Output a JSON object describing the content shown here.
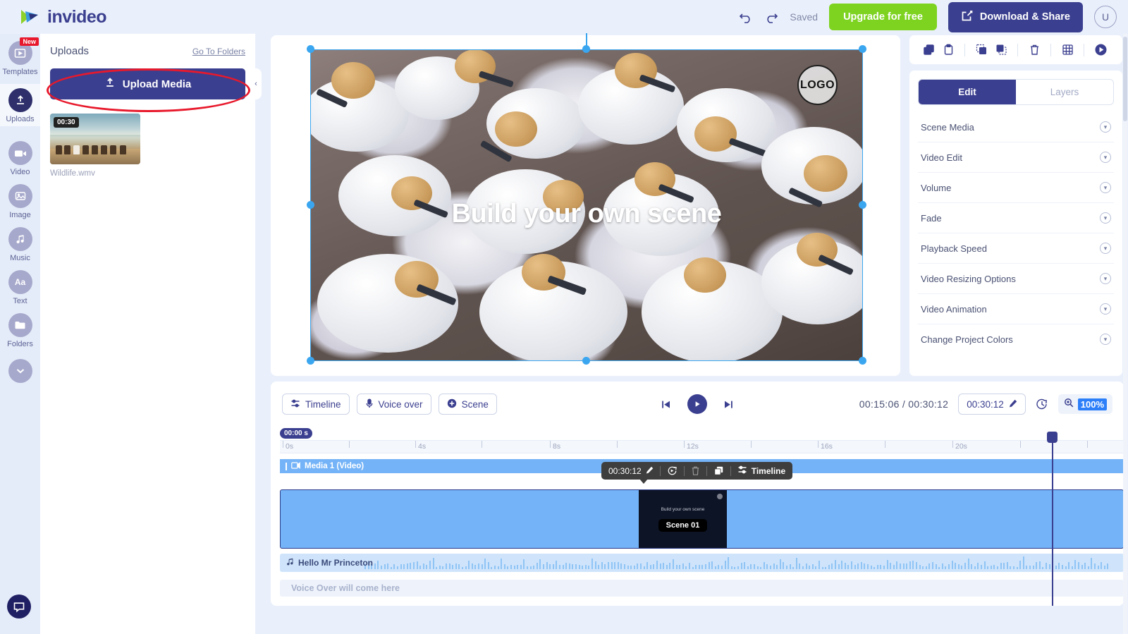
{
  "header": {
    "brand": "invideo",
    "undo_icon": "undo-icon",
    "redo_icon": "redo-icon",
    "saved_label": "Saved",
    "upgrade_label": "Upgrade for free",
    "download_label": "Download & Share",
    "avatar_initial": "U"
  },
  "rail": {
    "items": [
      {
        "label": "Templates",
        "icon": "templates-icon",
        "badge": "New",
        "active": false
      },
      {
        "label": "Uploads",
        "icon": "upload-icon",
        "badge": "",
        "active": true
      },
      {
        "label": "Video",
        "icon": "video-camera-icon",
        "badge": "",
        "active": false
      },
      {
        "label": "Image",
        "icon": "image-icon",
        "badge": "",
        "active": false
      },
      {
        "label": "Music",
        "icon": "music-note-icon",
        "badge": "",
        "active": false
      },
      {
        "label": "Text",
        "icon": "text-aa-icon",
        "badge": "",
        "active": false
      },
      {
        "label": "Folders",
        "icon": "folder-icon",
        "badge": "",
        "active": false
      },
      {
        "label": "",
        "icon": "chevron-down-icon",
        "badge": "",
        "active": false
      }
    ],
    "chat_icon": "chat-bubble-icon"
  },
  "panel": {
    "title": "Uploads",
    "link": "Go To Folders",
    "upload_button": "Upload Media",
    "upload_icon": "upload-arrow-icon",
    "media": [
      {
        "duration": "00:30",
        "name": "Wildlife.wmv"
      }
    ],
    "collapse_icon": "chevron-left-icon"
  },
  "canvas": {
    "logo_text": "LOGO",
    "scene_text": "Build your own scene"
  },
  "timeline": {
    "buttons": [
      {
        "label": "Timeline",
        "icon": "timeline-icon"
      },
      {
        "label": "Voice over",
        "icon": "microphone-icon"
      },
      {
        "label": "Scene",
        "icon": "plus-circle-icon"
      }
    ],
    "transport": {
      "prev_icon": "skip-previous-icon",
      "play_icon": "play-icon",
      "next_icon": "skip-next-icon"
    },
    "current_time": "00:15:06",
    "separator": "/",
    "total_time": "00:30:12",
    "duration_value": "00:30:12",
    "duration_edit_icon": "pencil-icon",
    "history_icon": "history-clock-icon",
    "zoom_icon": "zoom-in-icon",
    "zoom_value": "100%",
    "start_chip": "00:00 s",
    "ruler_labels": [
      "0s",
      "4s",
      "8s",
      "12s",
      "16s",
      "20s"
    ],
    "track_label": "Media 1 (Video)",
    "track_icon": "video-clip-icon",
    "clip_toolbar": {
      "duration": "00:30:12",
      "pencil_icon": "pencil-icon",
      "replace_icon": "replace-icon",
      "delete_icon": "trash-icon",
      "duplicate_icon": "duplicate-icon",
      "timeline_icon": "timeline-icon",
      "timeline_label": "Timeline"
    },
    "clip_thumb_text": "Build your own scene",
    "scene_chip": "Scene 01",
    "audio_icon": "music-note-icon",
    "audio_name": "Hello Mr Princeton",
    "voiceover_placeholder": "Voice Over will come here"
  },
  "right": {
    "tools": [
      {
        "name": "duplicate-icon"
      },
      {
        "name": "paste-icon"
      },
      {
        "name": "bring-to-front-icon"
      },
      {
        "name": "send-to-back-icon"
      },
      {
        "name": "trash-icon"
      },
      {
        "name": "grid-icon"
      },
      {
        "name": "preview-play-icon"
      }
    ],
    "tabs": [
      {
        "label": "Edit",
        "active": true
      },
      {
        "label": "Layers",
        "active": false
      }
    ],
    "options": [
      {
        "label": "Scene Media"
      },
      {
        "label": "Video Edit"
      },
      {
        "label": "Volume"
      },
      {
        "label": "Fade"
      },
      {
        "label": "Playback Speed"
      },
      {
        "label": "Video Resizing Options"
      },
      {
        "label": "Video Animation"
      },
      {
        "label": "Change Project Colors"
      }
    ]
  },
  "colors": {
    "brand_navy": "#3b3f8f",
    "green": "#7ed321",
    "blue_clip": "#74b3f7",
    "accent_blue": "#2d7ff9",
    "annotation_red": "#e8192c"
  }
}
